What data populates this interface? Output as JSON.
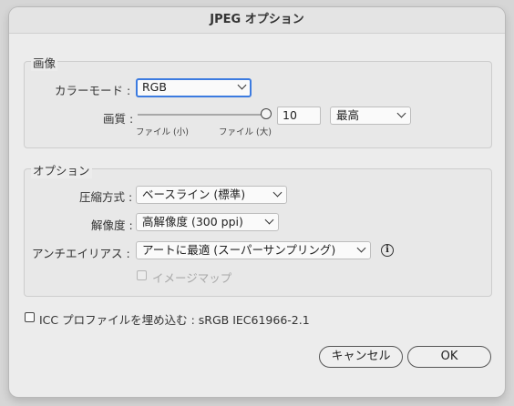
{
  "title": "JPEG オプション",
  "image_group": {
    "title": "画像",
    "color_mode_label": "カラーモード :",
    "color_mode_value": "RGB",
    "quality_label": "画質 :",
    "quality_value": "10",
    "quality_preset": "最高",
    "slider_min_label": "ファイル (小)",
    "slider_max_label": "ファイル (大)",
    "slider_level": 1.0
  },
  "options_group": {
    "title": "オプション",
    "compression_label": "圧縮方式 :",
    "compression_value": "ベースライン (標準)",
    "resolution_label": "解像度 :",
    "resolution_value": "高解像度 (300 ppi)",
    "antialias_label": "アンチエイリアス :",
    "antialias_value": "アートに最適 (スーパーサンプリング)",
    "info_icon": "i",
    "imagemap_label": "イメージマップ",
    "imagemap_checked": false
  },
  "icc": {
    "label": "ICC プロファイルを埋め込む : sRGB IEC61966-2.1",
    "checked": false
  },
  "buttons": {
    "cancel": "キャンセル",
    "ok": "OK"
  },
  "colors": {
    "focus_ring": "#3c7be0"
  }
}
